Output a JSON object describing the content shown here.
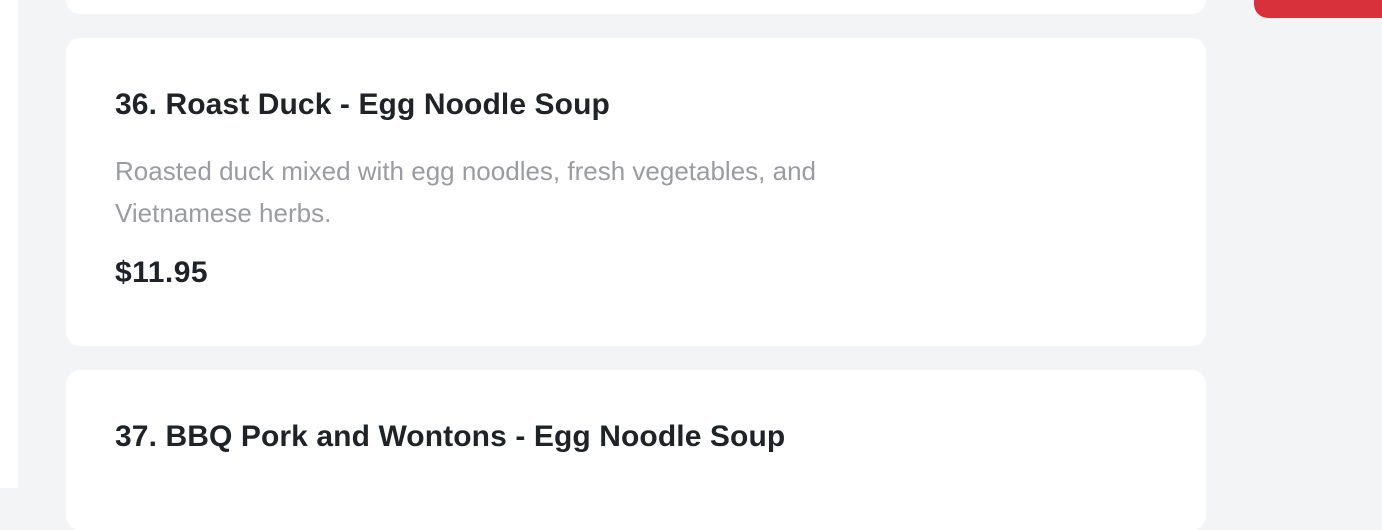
{
  "menu": {
    "items": [
      {
        "title": "36. Roast Duck - Egg Noodle Soup",
        "description": "Roasted duck mixed with egg noodles, fresh vegetables, and Vietnamese herbs.",
        "price": "$11.95"
      },
      {
        "title": "37. BBQ Pork and Wontons - Egg Noodle Soup"
      }
    ]
  },
  "colors": {
    "background": "#f3f4f6",
    "card": "#ffffff",
    "title": "#1f2328",
    "description": "#9a9ca0",
    "accent": "#d9313b"
  }
}
